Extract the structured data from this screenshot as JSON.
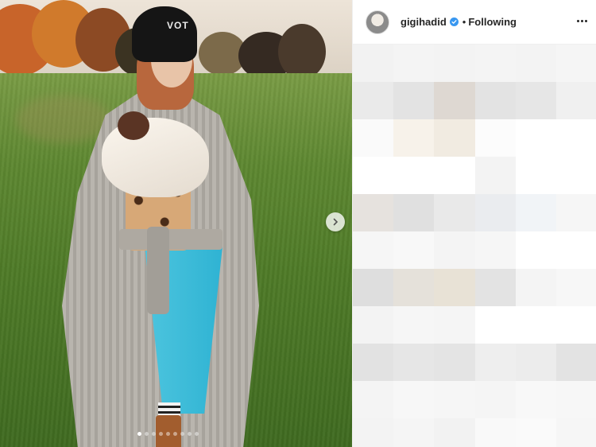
{
  "post": {
    "username": "gigihadid",
    "separator": "•",
    "follow_status": "Following",
    "beanie_text": "VOT",
    "carousel": {
      "total_slides": 9,
      "active_index": 0
    }
  },
  "colors": {
    "verified_badge": "#3897f0",
    "text": "#262626",
    "pants": "#2fb3d3"
  },
  "icons": {
    "verified": "verified-badge-icon",
    "next": "chevron-right-icon",
    "more": "more-options-icon"
  },
  "blurred_comments": {
    "rows": [
      [
        "#f2f2f2",
        "#f4f4f4",
        "#f3f3f3",
        "#f4f4f4",
        "#f3f3f3",
        "#f5f5f5"
      ],
      [
        "#eaeaea",
        "#e3e3e3",
        "#ded8d2",
        "#e3e3e3",
        "#e6e6e6",
        "#f0f0f0"
      ],
      [
        "#fafafa",
        "#f7f2ea",
        "#f1ebe1",
        "#fcfcfc",
        "#ffffff",
        "#ffffff"
      ],
      [
        "#ffffff",
        "#ffffff",
        "#ffffff",
        "#f3f3f3",
        "#ffffff",
        "#ffffff"
      ],
      [
        "#e6e2de",
        "#e0e0e0",
        "#e9e9e9",
        "#eaecef",
        "#f1f4f7",
        "#f6f6f6"
      ],
      [
        "#f6f6f6",
        "#f8f8f8",
        "#f4f4f4",
        "#f6f6f6",
        "#ffffff",
        "#ffffff"
      ],
      [
        "#dedede",
        "#e5e1da",
        "#e8e2d6",
        "#e3e3e3",
        "#f4f4f4",
        "#f7f7f7"
      ],
      [
        "#f3f3f3",
        "#f6f6f6",
        "#f5f5f5",
        "#ffffff",
        "#ffffff",
        "#ffffff"
      ],
      [
        "#e2e2e2",
        "#e6e6e6",
        "#e4e4e4",
        "#eeeeee",
        "#ececec",
        "#e3e3e3"
      ],
      [
        "#f4f4f4",
        "#f7f7f7",
        "#f6f6f6",
        "#f5f5f5",
        "#f8f8f8",
        "#f7f7f7"
      ],
      [
        "#f3f3f3",
        "#f5f5f5",
        "#f2f2f2",
        "#f9f9f9",
        "#fafafa",
        "#f6f6f6"
      ]
    ]
  }
}
